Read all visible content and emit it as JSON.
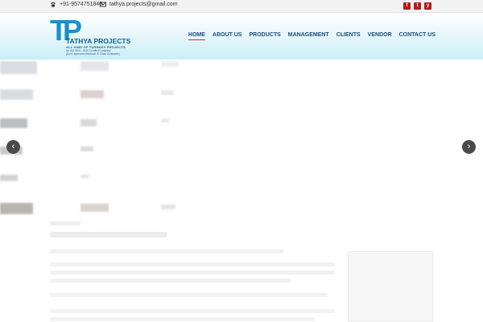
{
  "topbar": {
    "phone": "+91-9574751840",
    "email": "tathya.projects@gmail.com",
    "socials": [
      "f",
      "t",
      "y"
    ]
  },
  "logo": {
    "mark": "TP",
    "name": "TATHYA PROJECTS",
    "tagline": "ALL KIND OF TURNKEY PROJECTS",
    "cert_line1": "An ISO 9001 : 2015 Certified Company",
    "cert_line2": "(Govt. Approved Electrical 'A' Class Contractor)"
  },
  "nav": {
    "items": [
      "HOME",
      "ABOUT US",
      "PRODUCTS",
      "MANAGEMENT",
      "CLIENTS",
      "VENDOR",
      "CONTACT US"
    ],
    "active_index": 0
  },
  "slider": {
    "prev_glyph": "‹",
    "next_glyph": "›"
  },
  "colors": {
    "accent_red": "#c0392b",
    "nav_text": "#1a4d7a",
    "brand_blue": "#1b8fc9",
    "social_red": "#b51a1a"
  }
}
